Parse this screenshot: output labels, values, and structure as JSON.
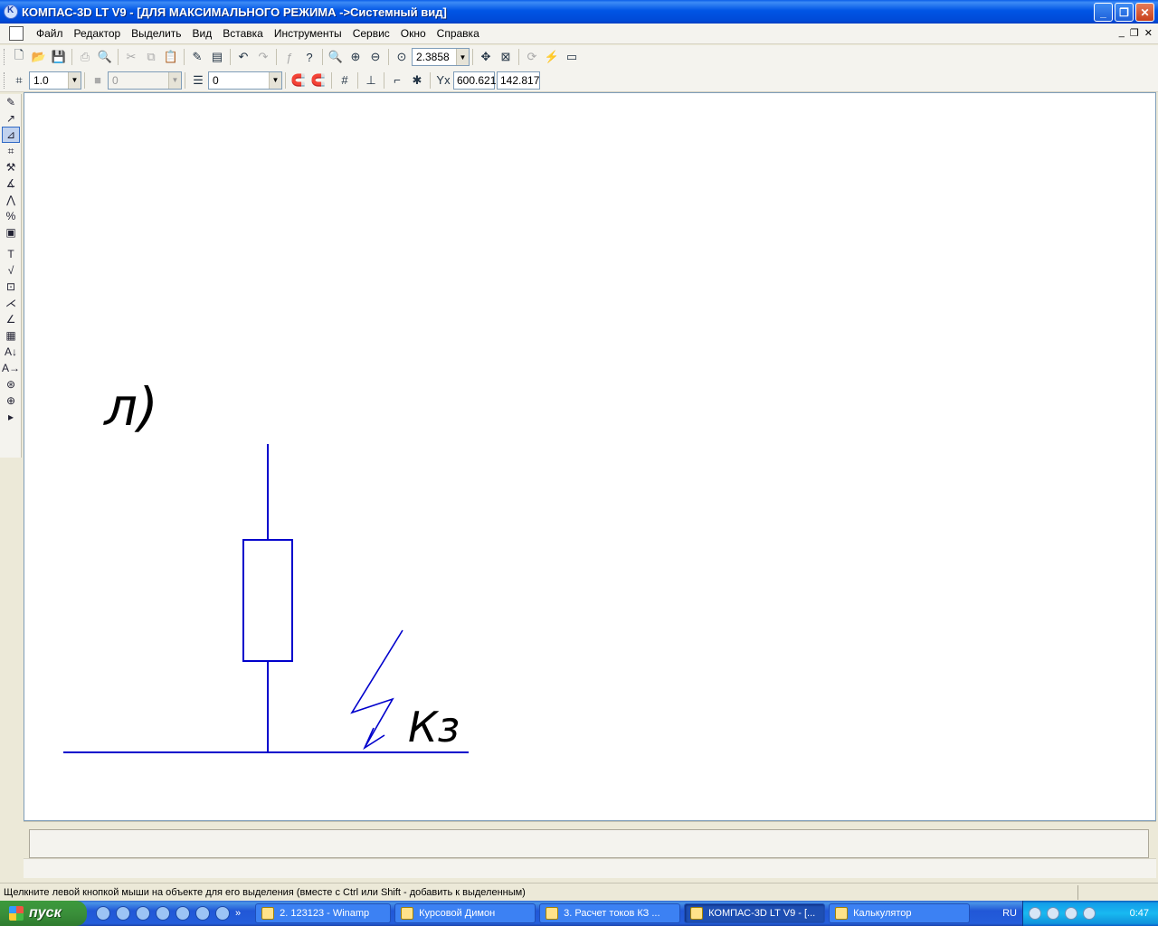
{
  "window": {
    "title": "КОМПАС-3D LT V9 - [ДЛЯ МАКСИМАЛЬНОГО РЕЖИМА ->Системный вид]",
    "minimize": "_",
    "restore": "❐",
    "close": "✕"
  },
  "menu": {
    "items": [
      "Файл",
      "Редактор",
      "Выделить",
      "Вид",
      "Вставка",
      "Инструменты",
      "Сервис",
      "Окно",
      "Справка"
    ],
    "mdi_minimize": "_",
    "mdi_restore": "❐",
    "mdi_close": "✕"
  },
  "toolbar1": {
    "zoom_value": "2.3858"
  },
  "toolbar2": {
    "step_value": "1.0",
    "style_value": "0",
    "layer_value": "0",
    "coord_label": "Yx",
    "coord_x": "600.621",
    "coord_y": "142.817"
  },
  "drawing": {
    "label_top": "л)",
    "label_kz": "Кз",
    "line_color": "#0000cc"
  },
  "status": {
    "hint": "Щелкните левой кнопкой мыши на объекте для его выделения (вместе с Ctrl или Shift - добавить к выделенным)"
  },
  "taskbar": {
    "start_label": "пуск",
    "more": "»",
    "tasks": [
      {
        "label": "2. 123123 - Winamp",
        "active": false
      },
      {
        "label": "Курсовой Димон",
        "active": false
      },
      {
        "label": "3. Расчет токов КЗ ...",
        "active": false
      },
      {
        "label": "КОМПАС-3D LT V9 - [...",
        "active": true
      },
      {
        "label": "Калькулятор",
        "active": false
      }
    ],
    "language": "RU",
    "clock": "0:47"
  }
}
